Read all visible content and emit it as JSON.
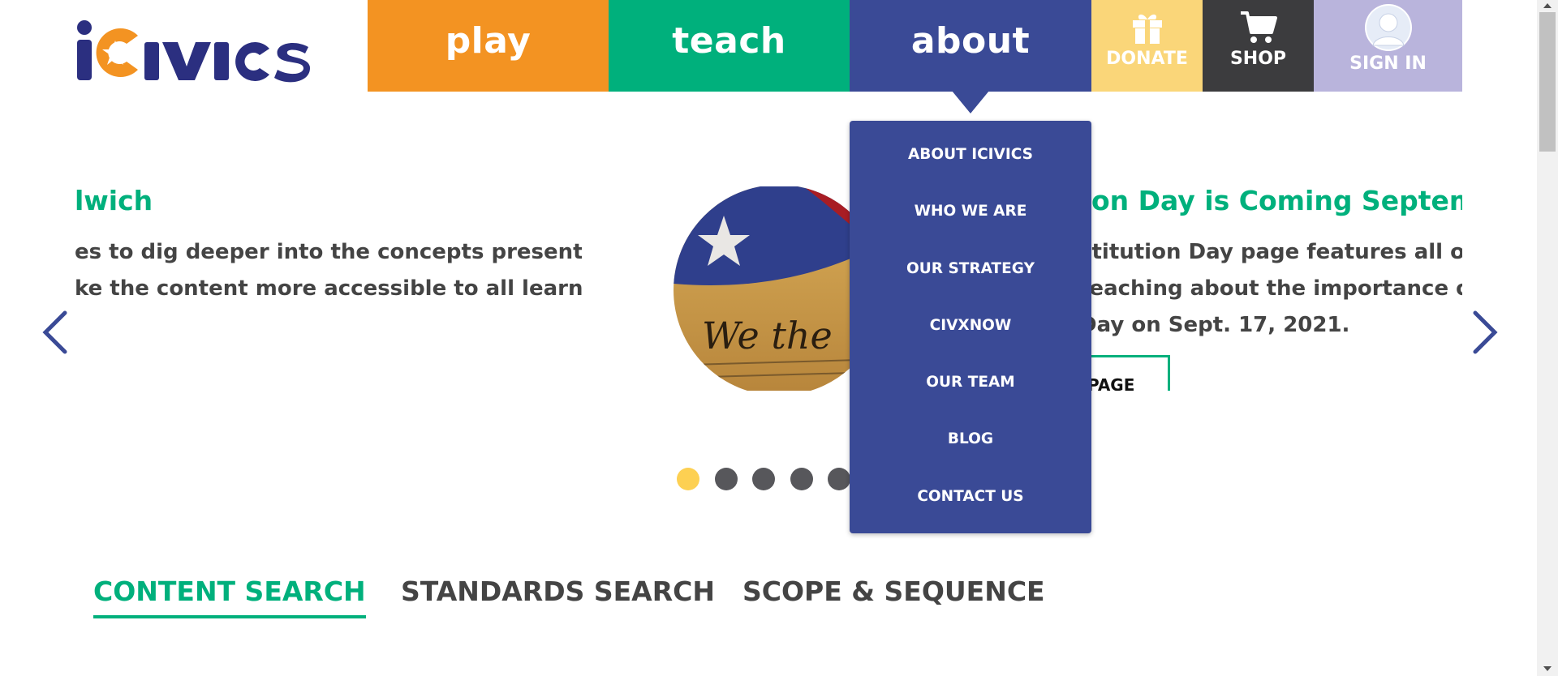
{
  "logo": {
    "text": "iCivics"
  },
  "nav": {
    "play": "play",
    "teach": "teach",
    "about": "about",
    "donate": "DONATE",
    "shop": "SHOP",
    "signin": "SIGN IN"
  },
  "about_menu": {
    "items": [
      "ABOUT ICIVICS",
      "WHO WE ARE",
      "OUR STRATEGY",
      "CIVXNOW",
      "OUR TEAM",
      "BLOG",
      "CONTACT US"
    ]
  },
  "carousel": {
    "left": {
      "title": "lwich!",
      "lines": [
        "es to dig deeper into the concepts presented,",
        "ke the content more accessible to all learners."
      ]
    },
    "right": {
      "title": "on Day is Coming Septembe",
      "lines": [
        "stitution Day page features all of o",
        "teaching about the importance of",
        "Day on Sept. 17, 2021."
      ],
      "button": "PAGE"
    },
    "slide_count": 5,
    "active_slide": 1
  },
  "tabs": {
    "content_search": "CONTENT SEARCH",
    "standards_search": "STANDARDS SEARCH",
    "scope_sequence": "SCOPE & SEQUENCE"
  },
  "colors": {
    "play": "#f39322",
    "teach": "#00b07c",
    "about": "#3a4a96",
    "donate": "#fad679",
    "shop": "#3c3c3e",
    "signin": "#b9b4dc",
    "dot_active": "#fdd052",
    "dot_inactive": "#57575b"
  },
  "icons": {
    "donate": "gift-icon",
    "shop": "shopping-cart-icon",
    "signin": "user-avatar-icon",
    "prev": "chevron-left-icon",
    "next": "chevron-right-icon"
  }
}
